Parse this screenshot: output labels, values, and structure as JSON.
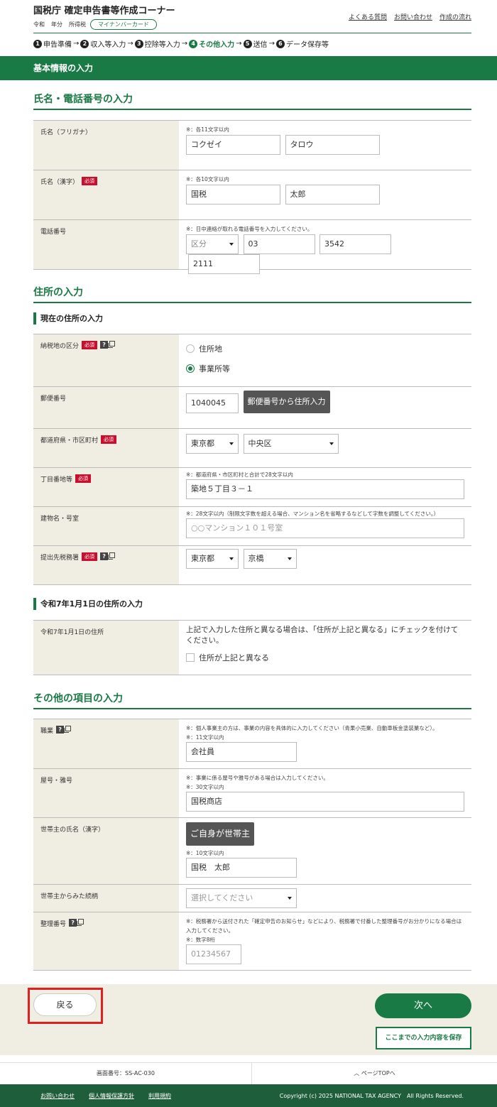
{
  "header": {
    "title": "国税庁 確定申告書等作成コーナー",
    "era": "令和",
    "year_label": "年分",
    "taxtype": "所得税",
    "mynumber_badge": "マイナンバーカード",
    "links": [
      "よくある質問",
      "お問い合わせ",
      "作成の流れ"
    ]
  },
  "steps": [
    {
      "num": "1",
      "label": "申告準備"
    },
    {
      "num": "2",
      "label": "収入等入力"
    },
    {
      "num": "3",
      "label": "控除等入力"
    },
    {
      "num": "4",
      "label": "その他入力",
      "active": true
    },
    {
      "num": "5",
      "label": "送信"
    },
    {
      "num": "6",
      "label": "データ保存等"
    }
  ],
  "band_title": "基本情報の入力",
  "name_section": {
    "title": "氏名・電話番号の入力",
    "furigana": {
      "label": "氏名（フリガナ）",
      "note": "※：各11文字以内",
      "last": "コクゼイ",
      "first": "タロウ"
    },
    "kanji": {
      "label": "氏名（漢字）",
      "required": "必須",
      "note": "※：各10文字以内",
      "last": "国税",
      "first": "太郎"
    },
    "phone": {
      "label": "電話番号",
      "note": "※：日中連絡が取れる電話番号を入力してください。",
      "type": "区分",
      "p1": "03",
      "p2": "3542",
      "p3": "2111"
    }
  },
  "address_section": {
    "title": "住所の入力",
    "current_subtitle": "現在の住所の入力",
    "tax_place": {
      "label": "納税地の区分",
      "required": "必須",
      "opt1": "住所地",
      "opt2": "事業所等"
    },
    "postal": {
      "label": "郵便番号",
      "value": "1040045",
      "button": "郵便番号から住所入力"
    },
    "pref_city": {
      "label": "都道府県・市区町村",
      "required": "必須",
      "pref": "東京都",
      "city": "中央区"
    },
    "street": {
      "label": "丁目番地等",
      "required": "必須",
      "note": "※：都道府県・市区町村と合計で28文字以内",
      "value": "築地５丁目３－１"
    },
    "building": {
      "label": "建物名・号室",
      "note": "※：28文字以内（制限文字数を超える場合、マンション名を省略するなどして字数を調整してください。）",
      "placeholder": "○○マンション１０１号室"
    },
    "office": {
      "label": "提出先税務署",
      "required": "必須",
      "pref": "東京都",
      "office": "京橋"
    },
    "jan1_subtitle": "令和7年1月1日の住所の入力",
    "jan1": {
      "label": "令和7年1月1日の住所",
      "text": "上記で入力した住所と異なる場合は、「住所が上記と異なる」にチェックを付けてください。",
      "check_label": "住所が上記と異なる"
    }
  },
  "other_section": {
    "title": "その他の項目の入力",
    "job": {
      "label": "職業",
      "note1": "※：個人事業主の方は、事業の内容を具体的に入力してください（青果小売業、自動車板金塗装業など）。",
      "note2": "※：11文字以内",
      "value": "会社員"
    },
    "trade_name": {
      "label": "屋号・雅号",
      "note1": "※：事業に係る屋号や雅号がある場合は入力してください。",
      "note2": "※：30文字以内",
      "value": "国税商店"
    },
    "householder": {
      "label": "世帯主の氏名（漢字）",
      "button": "ご自身が世帯主",
      "note": "※：10文字以内",
      "value": "国税　太郎"
    },
    "relation": {
      "label": "世帯主からみた続柄",
      "placeholder": "選択してください"
    },
    "ref_no": {
      "label": "整理番号",
      "note1": "※：税務署から送付された「確定申告のお知らせ」などにより、税務署で付番した整理番号がお分かりになる場合は入力してください。",
      "note2": "※：数字8桁",
      "placeholder": "01234567"
    }
  },
  "actions": {
    "back": "戻る",
    "next": "次へ",
    "save": "ここまでの入力内容を保存"
  },
  "screen_no": "画面番号：SS-AC-030",
  "page_top": "ページTOPへ",
  "footer": {
    "links": [
      "お問い合わせ",
      "個人情報保護方針",
      "利用規約"
    ],
    "copyright": "Copyright (c) 2025 NATIONAL TAX AGENCY　All Rights Reserved."
  }
}
